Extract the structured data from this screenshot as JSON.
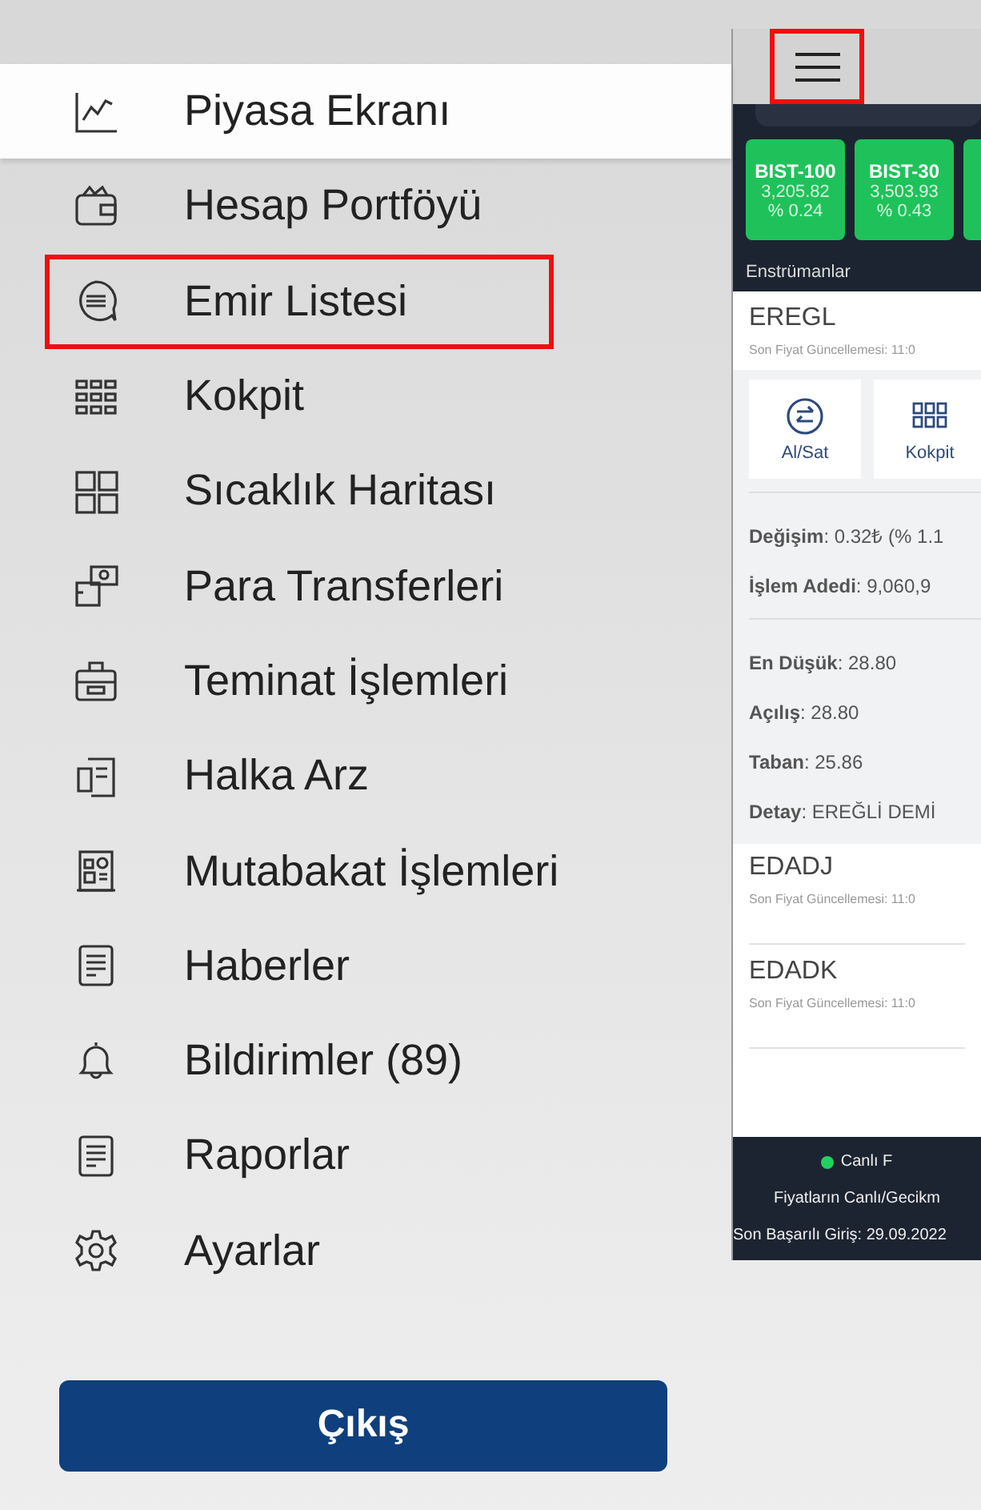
{
  "menu": {
    "items": [
      {
        "label": "Piyasa Ekranı",
        "selected": true,
        "highlighted": false
      },
      {
        "label": "Hesap Portföyü",
        "selected": false,
        "highlighted": false
      },
      {
        "label": "Emir Listesi",
        "selected": false,
        "highlighted": true
      },
      {
        "label": "Kokpit",
        "selected": false,
        "highlighted": false
      },
      {
        "label": "Sıcaklık Haritası",
        "selected": false,
        "highlighted": false
      },
      {
        "label": "Para Transferleri",
        "selected": false,
        "highlighted": false
      },
      {
        "label": "Teminat İşlemleri",
        "selected": false,
        "highlighted": false
      },
      {
        "label": "Halka Arz",
        "selected": false,
        "highlighted": false
      },
      {
        "label": "Mutabakat İşlemleri",
        "selected": false,
        "highlighted": false
      },
      {
        "label": "Haberler",
        "selected": false,
        "highlighted": false
      },
      {
        "label": "Bildirimler (89)",
        "selected": false,
        "highlighted": false
      },
      {
        "label": "Raporlar",
        "selected": false,
        "highlighted": false
      },
      {
        "label": "Ayarlar",
        "selected": false,
        "highlighted": false
      }
    ],
    "logout_button": "Çıkış"
  },
  "app_preview": {
    "menu_button_highlighted": true,
    "tickers": [
      {
        "name": "BIST-100",
        "value": "3,205.82",
        "change": "% 0.24"
      },
      {
        "name": "BIST-30",
        "value": "3,503.93",
        "change": "% 0.43"
      }
    ],
    "section_title": "Enstrümanlar",
    "instrument": {
      "symbol": "EREGL",
      "updated": "Son Fiyat Güncellemesi: 11:0",
      "actions": [
        "Al/Sat",
        "Kokpit"
      ],
      "details": [
        {
          "text": "**Değişim**: 0.32₺ (% 1.1",
          "divider_after": false
        },
        {
          "text": "**İşlem Adedi**: 9,060,9",
          "divider_after": true
        },
        {
          "text": "**En Düşük**: 28.80",
          "divider_after": false
        },
        {
          "text": "**Açılış**: 28.80",
          "divider_after": false
        },
        {
          "text": "**Taban**: 25.86",
          "divider_after": false
        },
        {
          "text": "**Detay**: EREĞLİ DEMİ",
          "divider_after": false
        }
      ]
    },
    "list": [
      {
        "symbol": "EDADJ",
        "updated": "Son Fiyat Güncellemesi: 11:0"
      },
      {
        "symbol": "EDADK",
        "updated": "Son Fiyat Güncellemesi: 11:0"
      }
    ],
    "footer": {
      "live": "Canlı F",
      "note": "Fiyatların Canlı/Gecikm",
      "last_login": "Son Başarılı Giriş: 29.09.2022"
    }
  }
}
